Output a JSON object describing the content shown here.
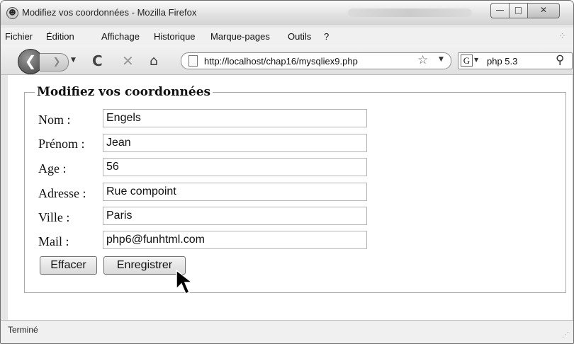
{
  "window": {
    "title": "Modifiez vos coordonnées - Mozilla Firefox",
    "minimize_glyph": "—",
    "maximize_glyph": "□",
    "close_glyph": "✕"
  },
  "menu": {
    "items": [
      "Fichier",
      "Édition",
      "Affichage",
      "Historique",
      "Marque-pages",
      "Outils",
      "?"
    ]
  },
  "navigation": {
    "back_icon": "back-arrow-icon",
    "forward_icon": "forward-arrow-icon",
    "url": "http://localhost/chap16/mysqliex9.php",
    "search_engine_glyph": "G",
    "search_text": "php 5.3"
  },
  "form": {
    "legend": "Modifiez vos coordonnées",
    "fields": [
      {
        "label": "Nom :",
        "value": "Engels"
      },
      {
        "label": "Prénom :",
        "value": "Jean"
      },
      {
        "label": "Age :",
        "value": "56"
      },
      {
        "label": "Adresse :",
        "value": "Rue compoint"
      },
      {
        "label": "Ville :",
        "value": "Paris"
      },
      {
        "label": "Mail :",
        "value": "php6@funhtml.com"
      }
    ],
    "reset_label": "Effacer",
    "submit_label": "Enregistrer"
  },
  "status": {
    "text": "Terminé"
  },
  "colors": {
    "title_bar": "#e2e2e2",
    "content_bg": "#ffffff",
    "border": "#a8a8a8"
  }
}
